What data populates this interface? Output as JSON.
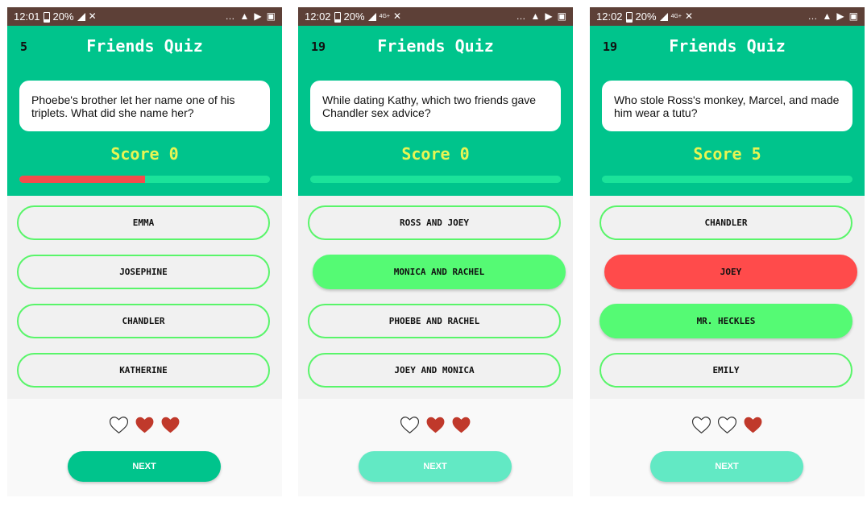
{
  "screens": [
    {
      "status": {
        "time": "12:01",
        "battery": "20%"
      },
      "question_number": "5",
      "title": "Friends Quiz",
      "question": "Phoebe's brother let her name one of his triplets. What did she name her?",
      "score": "Score 0",
      "progress": 0.5,
      "options": [
        "EMMA",
        "JOSEPHINE",
        "CHANDLER",
        "KATHERINE"
      ],
      "next_label": "NEXT"
    },
    {
      "status": {
        "time": "12:02",
        "battery": "20%"
      },
      "question_number": "19",
      "title": "Friends Quiz",
      "question": "While dating Kathy, which two friends gave Chandler sex advice?",
      "score": "Score 0",
      "progress": 0,
      "options": [
        "ROSS AND JOEY",
        "MONICA AND RACHEL",
        "PHOEBE AND RACHEL",
        "JOEY AND MONICA"
      ],
      "next_label": "NEXT"
    },
    {
      "status": {
        "time": "12:02",
        "battery": "20%"
      },
      "question_number": "19",
      "title": "Friends Quiz",
      "question": "Who stole Ross's monkey, Marcel, and made him wear a tutu?",
      "score": "Score 5",
      "progress": 0,
      "options": [
        "CHANDLER",
        "JOEY",
        "MR. HECKLES",
        "EMILY"
      ],
      "next_label": "NEXT"
    }
  ],
  "colors": {
    "status_bar": "#5d4037",
    "header": "#00c48c",
    "score_text": "#e8f553",
    "progress_track": "#1be39a",
    "progress_fill": "#f44b4b",
    "option_border": "#59f56a",
    "correct_option": "#55fa74",
    "wrong_option": "#ff4b4b",
    "heart_full": "#c0392b"
  },
  "icons": {
    "heart_full": "heart-filled-icon",
    "heart_empty": "heart-outline-icon"
  }
}
